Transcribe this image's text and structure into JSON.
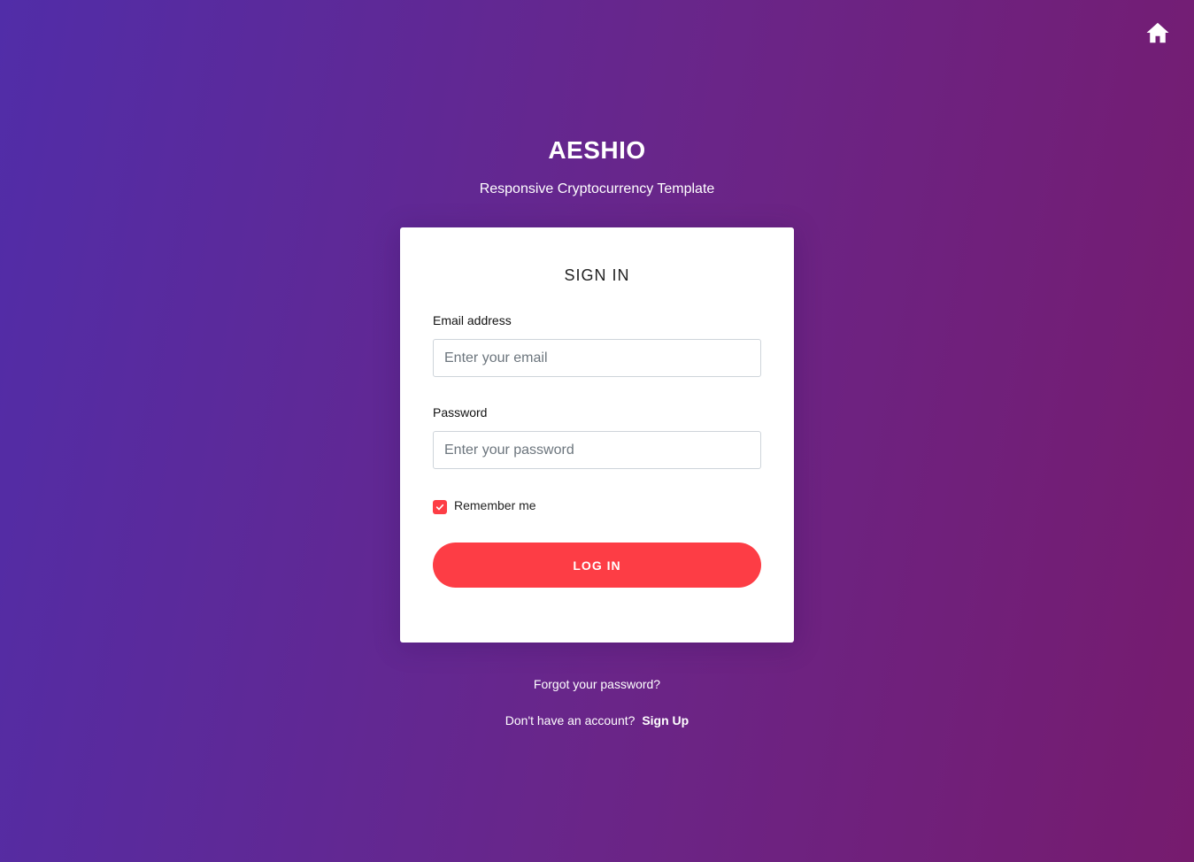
{
  "header": {
    "home_icon": "home-icon"
  },
  "brand": {
    "title": "AESHIO",
    "subtitle": "Responsive Cryptocurrency Template"
  },
  "sign_in_form": {
    "title": "SIGN IN",
    "email": {
      "label": "Email address",
      "placeholder": "Enter your email",
      "value": ""
    },
    "password": {
      "label": "Password",
      "placeholder": "Enter your password",
      "value": ""
    },
    "remember_me": {
      "label": "Remember me",
      "checked": true
    },
    "login_button_label": "LOG IN"
  },
  "footer_links": {
    "forgot_password": "Forgot your password?",
    "no_account_text": "Don't have an account?",
    "sign_up_label": "Sign Up"
  },
  "colors": {
    "background_start": "#512da8",
    "background_end": "#761b6e",
    "accent": "#fd3d45",
    "card": "#ffffff"
  }
}
